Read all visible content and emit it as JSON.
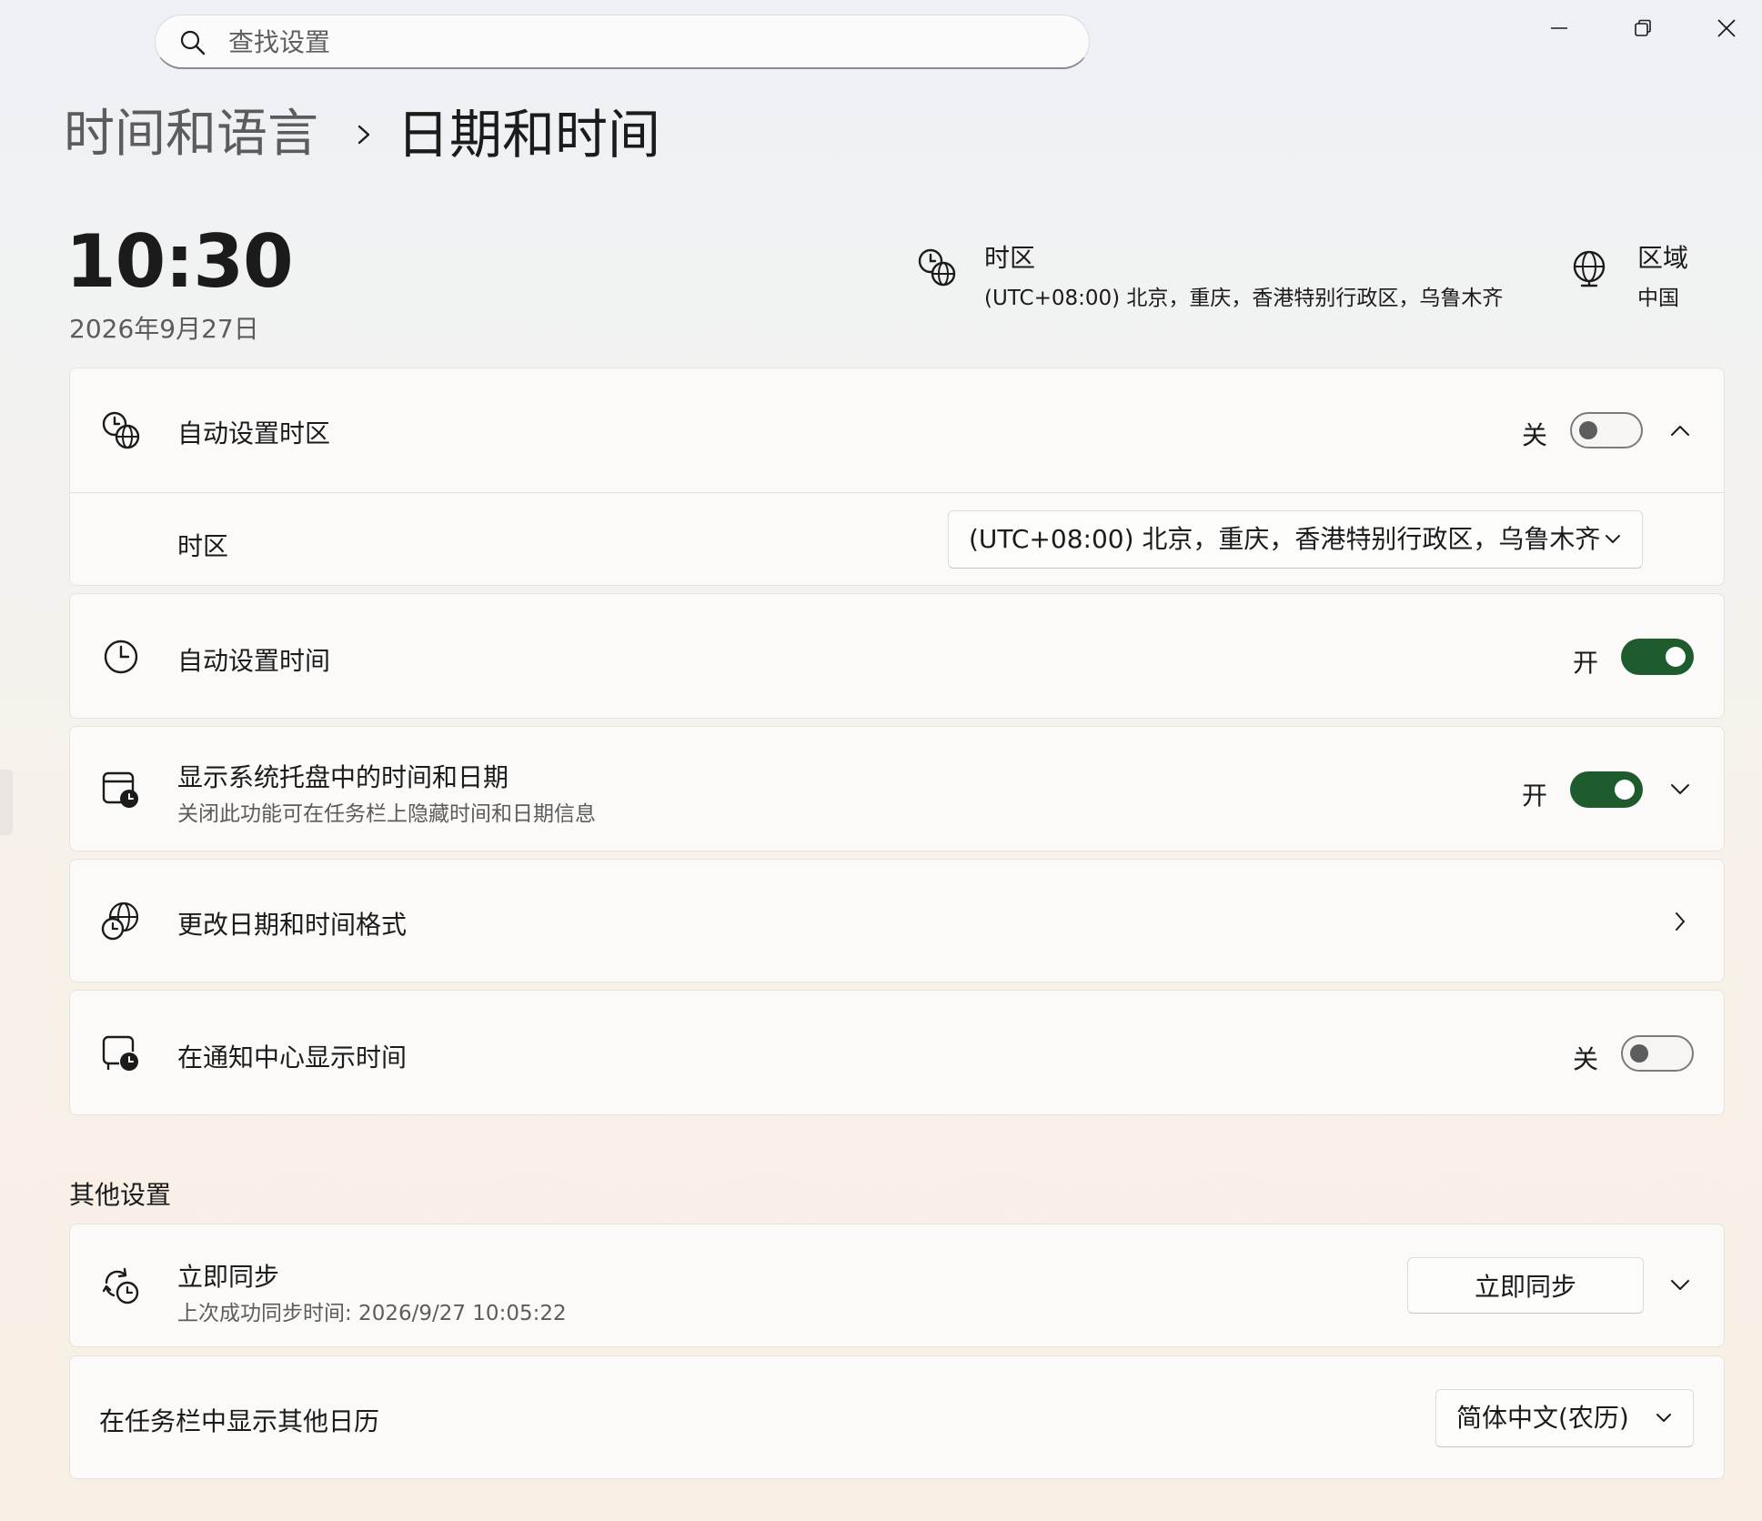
{
  "window": {
    "minimize_icon": "minimize-icon",
    "restore_icon": "restore-icon",
    "close_icon": "close-icon"
  },
  "search": {
    "placeholder": "查找设置",
    "value": ""
  },
  "breadcrumb": {
    "parent": "时间和语言",
    "current": "日期和时间"
  },
  "clock": {
    "time": "10:30",
    "date": "2026年9月27日"
  },
  "header_info": {
    "timezone": {
      "title": "时区",
      "value": "(UTC+08:00) 北京，重庆，香港特别行政区，乌鲁木齐"
    },
    "region": {
      "title": "区域",
      "value": "中国"
    }
  },
  "rows": {
    "auto_timezone": {
      "title": "自动设置时区",
      "state": "关",
      "on": false
    },
    "timezone_select": {
      "label": "时区",
      "selected": "(UTC+08:00) 北京，重庆，香港特别行政区，乌鲁木齐"
    },
    "auto_time": {
      "title": "自动设置时间",
      "state": "开",
      "on": true
    },
    "tray_time": {
      "title": "显示系统托盘中的时间和日期",
      "subtitle": "关闭此功能可在任务栏上隐藏时间和日期信息",
      "state": "开",
      "on": true
    },
    "format": {
      "title": "更改日期和时间格式"
    },
    "notify_time": {
      "title": "在通知中心显示时间",
      "state": "关",
      "on": false
    }
  },
  "other": {
    "section_title": "其他设置",
    "sync": {
      "title": "立即同步",
      "subtitle": "上次成功同步时间: 2026/9/27 10:05:22",
      "button": "立即同步"
    },
    "calendar": {
      "title": "在任务栏中显示其他日历",
      "selected": "简体中文(农历)"
    }
  },
  "colors": {
    "accent": "#1e5c2e",
    "toggle_off_knob": "#5d5d5d"
  }
}
